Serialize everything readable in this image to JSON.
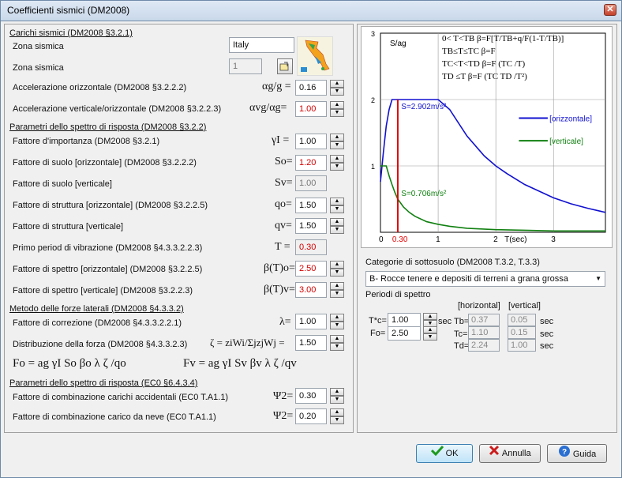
{
  "window": {
    "title": "Coefficienti sismici (DM2008)"
  },
  "sections": {
    "carichi": "Carichi sismici (DM2008 §3.2.1)",
    "parametri": "Parametri dello spettro di risposta (DM2008 §3.2.2)",
    "metodo": "Metodo delle forze laterali (DM2008 §4.3.3.2)",
    "parametri_ec0": "Parametri dello spettro di risposta (EC0 §6.4.3.4)"
  },
  "rows": {
    "zona_sismica_name": {
      "label": "Zona sismica",
      "value": "Italy"
    },
    "zona_sismica_num": {
      "label": "Zona sismica",
      "value": "1"
    },
    "acc_orizz": {
      "label": "Accelerazione orizzontale (DM2008 §3.2.2.2)",
      "symbol": "αg/g =",
      "value": "0.16"
    },
    "acc_vert": {
      "label": "Accelerazione verticale/orizzontale (DM2008 §3.2.2.3)",
      "symbol": "αvg/αg=",
      "value": "1.00"
    },
    "fattore_importanza": {
      "label": "Fattore d'importanza (DM2008 §3.2.1)",
      "symbol": "γI =",
      "value": "1.00"
    },
    "suolo_orizz": {
      "label": "Fattore di suolo [orizzontale] (DM2008 §3.2.2.2)",
      "symbol": "So=",
      "value": "1.20"
    },
    "suolo_vert": {
      "label": "Fattore di suolo [verticale]",
      "symbol": "Sv=",
      "value": "1.00"
    },
    "struttura_orizz": {
      "label": "Fattore di struttura [orizzontale] (DM2008 §3.2.2.5)",
      "symbol": "qo=",
      "value": "1.50"
    },
    "struttura_vert": {
      "label": "Fattore di struttura [verticale]",
      "symbol": "qv=",
      "value": "1.50"
    },
    "primo_periodo": {
      "label": "Primo period di vibrazione (DM2008 §4.3.3.2.2.3)",
      "symbol": "T =",
      "value": "0.30"
    },
    "spettro_orizz": {
      "label": "Fattore di spettro [orizzontale] (DM2008 §3.2.2.5)",
      "symbol": "β(T)o=",
      "value": "2.50"
    },
    "spettro_vert": {
      "label": "Fattore di spettro [verticale] (DM2008 §3.2.2.3)",
      "symbol": "β(T)v=",
      "value": "3.00"
    },
    "correzione": {
      "label": "Fattore di correzione (DM2008 §4.3.3.2.2.1)",
      "symbol": "λ=",
      "value": "1.00"
    },
    "distribuzione": {
      "label": "Distribuzione della forza (DM2008 §4.3.3.2.3)",
      "symbol": "ζ = ziWi/ΣjzjWj =",
      "value": "1.50"
    },
    "comb_accidentali": {
      "label": "Fattore di combinazione carichi accidentali (EC0 T.A1.1)",
      "symbol": "Ψ2=",
      "value": "0.30"
    },
    "comb_neve": {
      "label": "Fattore di combinazione carico da neve (EC0 T.A1.1)",
      "symbol": "Ψ2=",
      "value": "0.20"
    }
  },
  "formulas": {
    "fo": "Fo = ag γI So βo λ ζ /qo",
    "fv": "Fv = ag γI Sv βv λ ζ /qv"
  },
  "chart_text": {
    "ylabel": "S/ag",
    "eq1": "0< T<TB  β=F[T/TB+q/F(1-T/TB)]",
    "eq2": "TB≤T≤TC  β=F",
    "eq3": "TC<T<TD  β=F (TC /T)",
    "eq4": "TD  ≤T   β=F  (TC TD /T²)",
    "ann_h": "S=2.902m/s²",
    "ann_v": "S=0.706m/s²",
    "legend_h": "[orizzontale]",
    "legend_v": "[verticale]",
    "xlabel": "T(sec)"
  },
  "chart_data": {
    "type": "line",
    "xlabel": "T(sec)",
    "ylabel": "S/ag",
    "xlim": [
      0,
      3.9
    ],
    "ylim": [
      0,
      3
    ],
    "x_ticks": [
      "0",
      "0.30",
      "1",
      "2",
      "3"
    ],
    "y_ticks": [
      "1",
      "2",
      "3"
    ],
    "grid": true,
    "legend_position": "right",
    "series": [
      {
        "name": "[orizzontale]",
        "color": "#1010d0",
        "x": [
          0,
          0.05,
          0.1,
          0.15,
          0.2,
          0.25,
          0.3,
          0.5,
          0.8,
          1.0,
          1.2,
          1.5,
          1.8,
          2.0,
          2.2,
          2.5,
          2.8,
          3.0,
          3.3,
          3.6,
          3.9
        ],
        "y": [
          0.76,
          1.2,
          1.6,
          1.85,
          2.0,
          2.0,
          2.0,
          2.0,
          2.0,
          2.0,
          1.85,
          1.45,
          1.15,
          1.0,
          0.88,
          0.72,
          0.6,
          0.52,
          0.43,
          0.36,
          0.3
        ]
      },
      {
        "name": "[verticale]",
        "color": "#108010",
        "x": [
          0,
          0.05,
          0.1,
          0.15,
          0.2,
          0.25,
          0.3,
          0.4,
          0.5,
          0.6,
          0.8,
          1.0,
          1.2,
          1.5,
          2.0,
          2.5,
          3.0,
          3.5,
          3.9
        ],
        "y": [
          1.0,
          1.0,
          1.0,
          0.85,
          0.72,
          0.6,
          0.5,
          0.38,
          0.3,
          0.24,
          0.16,
          0.12,
          0.09,
          0.06,
          0.04,
          0.03,
          0.02,
          0.02,
          0.02
        ]
      }
    ],
    "marker_x": 0.3,
    "annotations": [
      "S=2.902m/s²",
      "S=0.706m/s²"
    ]
  },
  "right": {
    "categorie_label": "Categorie di sottosuolo (DM2008 T.3.2, T.3.3)",
    "categorie_value": "B- Rocce tenere e depositi di terreni a grana grossa",
    "periodi_label": "Periodi di spettro",
    "col_horizontal": "[horizontal]",
    "col_vertical": "[vertical]",
    "tc_star_label": "T*c=",
    "tc_star_value": "1.00",
    "fo_label": "Fo=",
    "fo_value": "2.50",
    "sec": "sec",
    "tb_label": "Tb=",
    "tc_label": "Tc=",
    "td_label": "Td=",
    "tb_h": "0.37",
    "tb_v": "0.05",
    "tc_h": "1.10",
    "tc_v": "0.15",
    "td_h": "2.24",
    "td_v": "1.00"
  },
  "buttons": {
    "ok": "OK",
    "annulla": "Annulla",
    "guida": "Guida"
  },
  "colors": {
    "red_value": "#d40000",
    "horizontal": "#1010d0",
    "vertical": "#108010",
    "marker": "#e00000"
  }
}
